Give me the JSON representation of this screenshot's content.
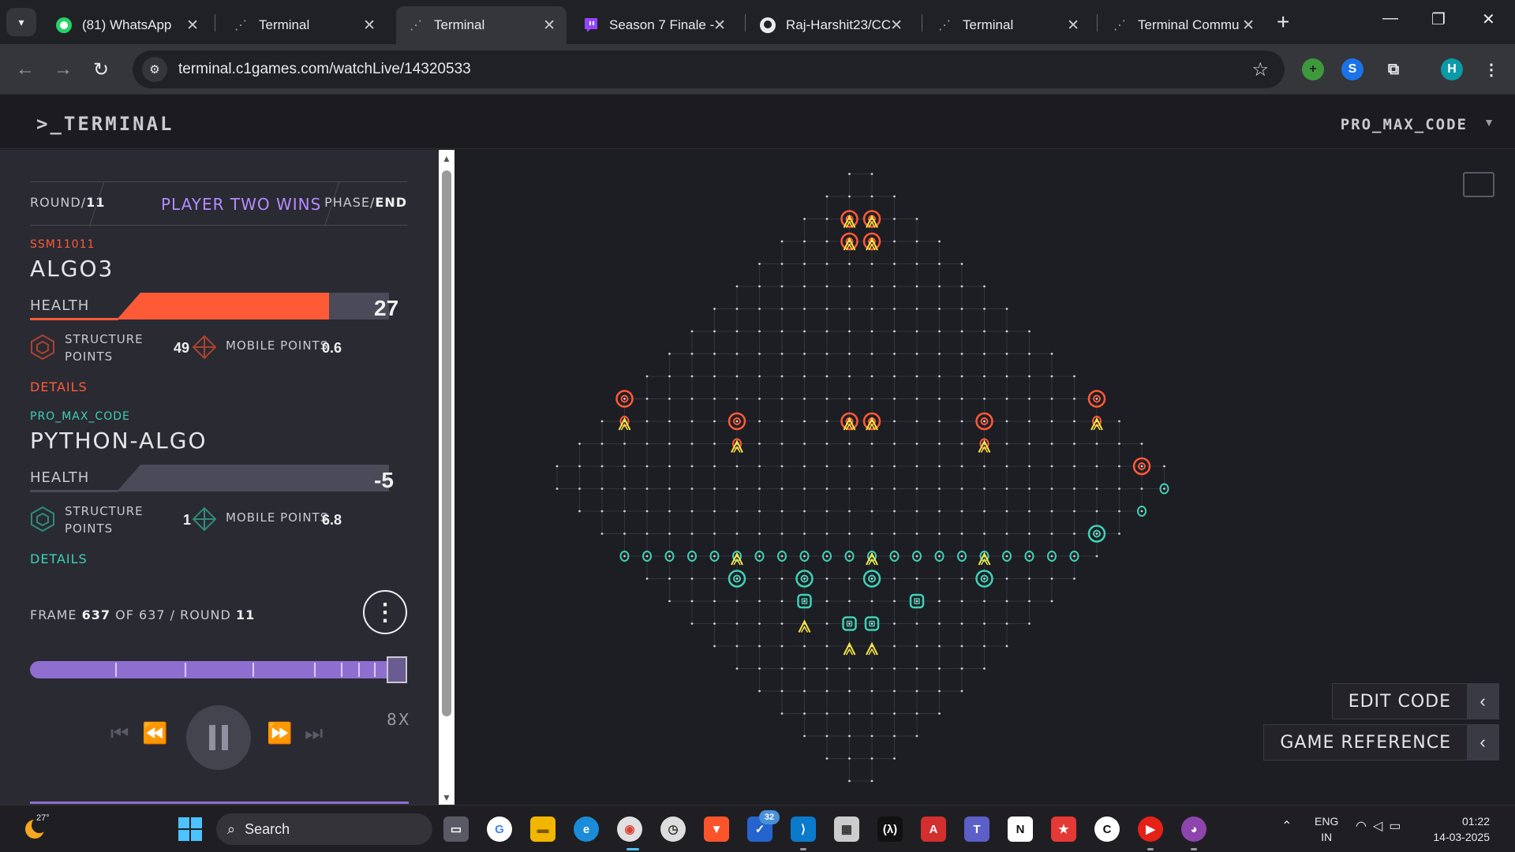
{
  "browser": {
    "tabs": [
      {
        "title": "(81) WhatsApp",
        "icon": "whatsapp-icon",
        "active": false
      },
      {
        "title": "Terminal",
        "icon": "terminal-favicon",
        "active": false
      },
      {
        "title": "Terminal",
        "icon": "terminal-favicon",
        "active": true
      },
      {
        "title": "Season 7 Finale -",
        "icon": "twitch-icon",
        "active": false
      },
      {
        "title": "Raj-Harshit23/CC",
        "icon": "github-icon",
        "active": false
      },
      {
        "title": "Terminal",
        "icon": "terminal-favicon",
        "active": false
      },
      {
        "title": "Terminal Commu",
        "icon": "terminal-favicon",
        "active": false
      }
    ],
    "url": "terminal.c1games.com/watchLive/14320533",
    "profile_initial": "H"
  },
  "site": {
    "logo": ">_TERMINAL",
    "username": "PRO_MAX_CODE"
  },
  "match": {
    "round_label": "ROUND/",
    "round_value": "11",
    "winner": "PLAYER TWO WINS",
    "phase_label": "PHASE/",
    "phase_value": "END",
    "players": [
      {
        "username": "SSM11011",
        "algo": "ALGO3",
        "health_label": "HEALTH",
        "health": "27",
        "health_fraction": 0.78,
        "structure_label_1": "STRUCTURE",
        "structure_label_2": "POINTS",
        "structure_points": "49",
        "mobile_label": "MOBILE POINTS",
        "mobile_points": "0.6",
        "details": "DETAILS",
        "color": "#ff5a36"
      },
      {
        "username": "PRO_MAX_CODE",
        "algo": "PYTHON-ALGO",
        "health_label": "HEALTH",
        "health": "-5",
        "health_fraction": 0,
        "structure_label_1": "STRUCTURE",
        "structure_label_2": "POINTS",
        "structure_points": "1",
        "mobile_label": "MOBILE POINTS",
        "mobile_points": "6.8",
        "details": "DETAILS",
        "color": "#3fd1b5"
      }
    ],
    "frame_prefix": "FRAME",
    "frame": "637",
    "of_label": "OF",
    "total_frames": "637",
    "round_sep": "/ ROUND",
    "frame_round": "11",
    "speed": "8X",
    "timeline_progress": 1.0
  },
  "buttons": {
    "edit_code": "EDIT CODE",
    "game_reference": "GAME REFERENCE"
  },
  "taskbar": {
    "temperature": "27°",
    "search_placeholder": "Search",
    "notification_badge": "32",
    "lang_line1": "ENG",
    "lang_line2": "IN",
    "time": "01:22",
    "date": "14-03-2025"
  },
  "colors": {
    "enemy": "#ff5a36",
    "ally": "#3fd1b5",
    "upgrade": "#f5e642",
    "accent": "#b48cff"
  },
  "board": {
    "grid_size": 28,
    "enemy_turrets": [
      [
        13,
        25
      ],
      [
        14,
        25
      ],
      [
        13,
        24
      ],
      [
        14,
        24
      ],
      [
        3,
        17
      ],
      [
        8,
        16
      ],
      [
        13,
        16
      ],
      [
        14,
        16
      ],
      [
        19,
        16
      ],
      [
        24,
        17
      ],
      [
        26,
        14
      ]
    ],
    "enemy_walls_upgraded_markers": [
      [
        13,
        25
      ],
      [
        14,
        25
      ],
      [
        13,
        24
      ],
      [
        14,
        24
      ],
      [
        3,
        16
      ],
      [
        8,
        15
      ],
      [
        13,
        16
      ],
      [
        14,
        16
      ],
      [
        19,
        15
      ],
      [
        24,
        16
      ]
    ],
    "ally_walls": [
      [
        3,
        10
      ],
      [
        4,
        10
      ],
      [
        5,
        10
      ],
      [
        6,
        10
      ],
      [
        7,
        10
      ],
      [
        8,
        10
      ],
      [
        9,
        10
      ],
      [
        10,
        10
      ],
      [
        11,
        10
      ],
      [
        12,
        10
      ],
      [
        13,
        10
      ],
      [
        14,
        10
      ],
      [
        15,
        10
      ],
      [
        16,
        10
      ],
      [
        17,
        10
      ],
      [
        18,
        10
      ],
      [
        19,
        10
      ],
      [
        20,
        10
      ],
      [
        21,
        10
      ],
      [
        22,
        10
      ],
      [
        23,
        10
      ],
      [
        26,
        12
      ],
      [
        27,
        13
      ]
    ],
    "ally_turrets": [
      [
        8,
        9
      ],
      [
        11,
        9
      ],
      [
        14,
        9
      ],
      [
        19,
        9
      ],
      [
        24,
        11
      ]
    ],
    "ally_supports": [
      [
        11,
        8
      ],
      [
        16,
        8
      ],
      [
        13,
        7
      ],
      [
        14,
        7
      ]
    ],
    "ally_upgrade_markers": [
      [
        8,
        10
      ],
      [
        14,
        10
      ],
      [
        19,
        10
      ],
      [
        11,
        7
      ],
      [
        13,
        6
      ],
      [
        14,
        6
      ]
    ]
  }
}
